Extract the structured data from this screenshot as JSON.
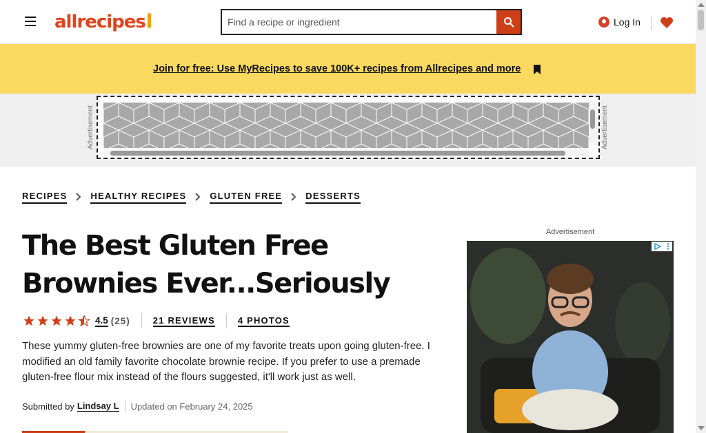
{
  "header": {
    "logo_text": "allrecipes",
    "search_placeholder": "Find a recipe or ingredient",
    "login_label": "Log In"
  },
  "promo": {
    "link_text": "Join for free: Use MyRecipes to save 100K+ recipes from Allrecipes and more"
  },
  "ads": {
    "vertical_label": "Advertisement",
    "side_label": "Advertisement"
  },
  "breadcrumb": [
    {
      "label": "RECIPES"
    },
    {
      "label": "HEALTHY RECIPES"
    },
    {
      "label": "GLUTEN FREE"
    },
    {
      "label": "DESSERTS"
    }
  ],
  "recipe": {
    "title": "The Best Gluten Free Brownies Ever...Seriously",
    "rating_value": 4.5,
    "rating_display": "4.5",
    "rating_count": "(25)",
    "reviews_link": "21 REVIEWS",
    "photos_link": "4 PHOTOS",
    "description": "These yummy gluten-free brownies are one of my favorite treats upon going gluten-free. I modified an old family favorite chocolate brownie recipe. If you prefer to use a premade gluten-free flour mix instead of the flours suggested, it'll work just as well.",
    "submitted_label": "Submitted by",
    "author": "Lindsay L",
    "updated": "Updated on February 24, 2025"
  },
  "colors": {
    "brand": "#cf3f17",
    "promo_bg": "#fbd960",
    "star": "#cf3f17"
  }
}
